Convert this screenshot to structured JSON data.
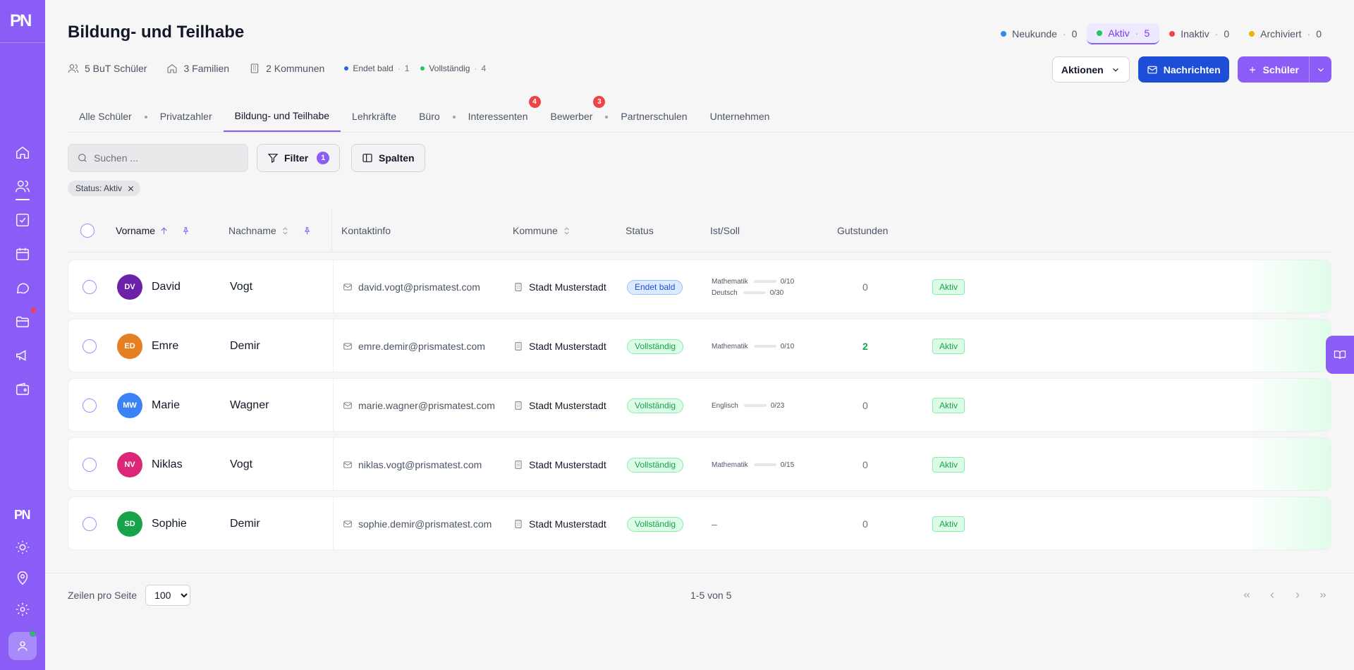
{
  "app": {
    "logo": "PN"
  },
  "header": {
    "title": "Bildung- und Teilhabe",
    "stats": [
      {
        "icon": "users-icon",
        "label": "5 BuT Schüler"
      },
      {
        "icon": "home-icon",
        "label": "3 Familien"
      },
      {
        "icon": "building-icon",
        "label": "2 Kommunen"
      }
    ],
    "mini_stats": [
      {
        "label": "Endet bald",
        "count": "1",
        "color": "#2563eb"
      },
      {
        "label": "Vollständig",
        "count": "4",
        "color": "#22c55e"
      }
    ],
    "status_filters": [
      {
        "label": "Neukunde",
        "count": "0",
        "color": "#3b82f6"
      },
      {
        "label": "Aktiv",
        "count": "5",
        "color": "#22c55e",
        "active": true
      },
      {
        "label": "Inaktiv",
        "count": "0",
        "color": "#ef4444"
      },
      {
        "label": "Archiviert",
        "count": "0",
        "color": "#eab308"
      }
    ],
    "actions_label": "Aktionen",
    "messages_label": "Nachrichten",
    "add_student_label": "Schüler"
  },
  "tabs": [
    {
      "label": "Alle Schüler"
    },
    {
      "label": "Privatzahler"
    },
    {
      "label": "Bildung- und Teilhabe",
      "active": true
    },
    {
      "label": "Lehrkräfte"
    },
    {
      "label": "Büro"
    },
    {
      "label": "Interessenten",
      "badge": "4"
    },
    {
      "label": "Bewerber",
      "badge": "3"
    },
    {
      "label": "Partnerschulen"
    },
    {
      "label": "Unternehmen"
    }
  ],
  "toolbar": {
    "search_placeholder": "Suchen ...",
    "filter_label": "Filter",
    "filter_count": "1",
    "columns_label": "Spalten",
    "active_chip": "Status: Aktiv"
  },
  "table": {
    "columns": {
      "vorname": "Vorname",
      "nachname": "Nachname",
      "kontakt": "Kontaktinfo",
      "kommune": "Kommune",
      "status": "Status",
      "istsoll": "Ist/Soll",
      "gutstunden": "Gutstunden"
    },
    "rows": [
      {
        "initials": "DV",
        "avatar_color": "#6b21a8",
        "first": "David",
        "last": "Vogt",
        "email": "david.vogt@prismatest.com",
        "kommune": "Stadt Musterstadt",
        "status": "Endet bald",
        "status_type": "blue",
        "subjects": [
          {
            "name": "Mathematik",
            "value": "0/10"
          },
          {
            "name": "Deutsch",
            "value": "0/30"
          }
        ],
        "gutstunden": "0",
        "state": "Aktiv"
      },
      {
        "initials": "ED",
        "avatar_color": "#e67e22",
        "first": "Emre",
        "last": "Demir",
        "email": "emre.demir@prismatest.com",
        "kommune": "Stadt Musterstadt",
        "status": "Vollständig",
        "status_type": "green",
        "subjects": [
          {
            "name": "Mathematik",
            "value": "0/10"
          }
        ],
        "gutstunden": "2",
        "state": "Aktiv"
      },
      {
        "initials": "MW",
        "avatar_color": "#3b82f6",
        "first": "Marie",
        "last": "Wagner",
        "email": "marie.wagner@prismatest.com",
        "kommune": "Stadt Musterstadt",
        "status": "Vollständig",
        "status_type": "green",
        "subjects": [
          {
            "name": "Englisch",
            "value": "0/23"
          }
        ],
        "gutstunden": "0",
        "state": "Aktiv"
      },
      {
        "initials": "NV",
        "avatar_color": "#db2777",
        "first": "Niklas",
        "last": "Vogt",
        "email": "niklas.vogt@prismatest.com",
        "kommune": "Stadt Musterstadt",
        "status": "Vollständig",
        "status_type": "green",
        "subjects": [
          {
            "name": "Mathematik",
            "value": "0/15"
          }
        ],
        "gutstunden": "0",
        "state": "Aktiv"
      },
      {
        "initials": "SD",
        "avatar_color": "#16a34a",
        "first": "Sophie",
        "last": "Demir",
        "email": "sophie.demir@prismatest.com",
        "kommune": "Stadt Musterstadt",
        "status": "Vollständig",
        "status_type": "green",
        "subjects": [],
        "empty_subjects": "–",
        "gutstunden": "0",
        "state": "Aktiv"
      }
    ]
  },
  "footer": {
    "rows_per_page_label": "Zeilen pro Seite",
    "rows_per_page_value": "100",
    "count_label": "1-5 von 5"
  }
}
